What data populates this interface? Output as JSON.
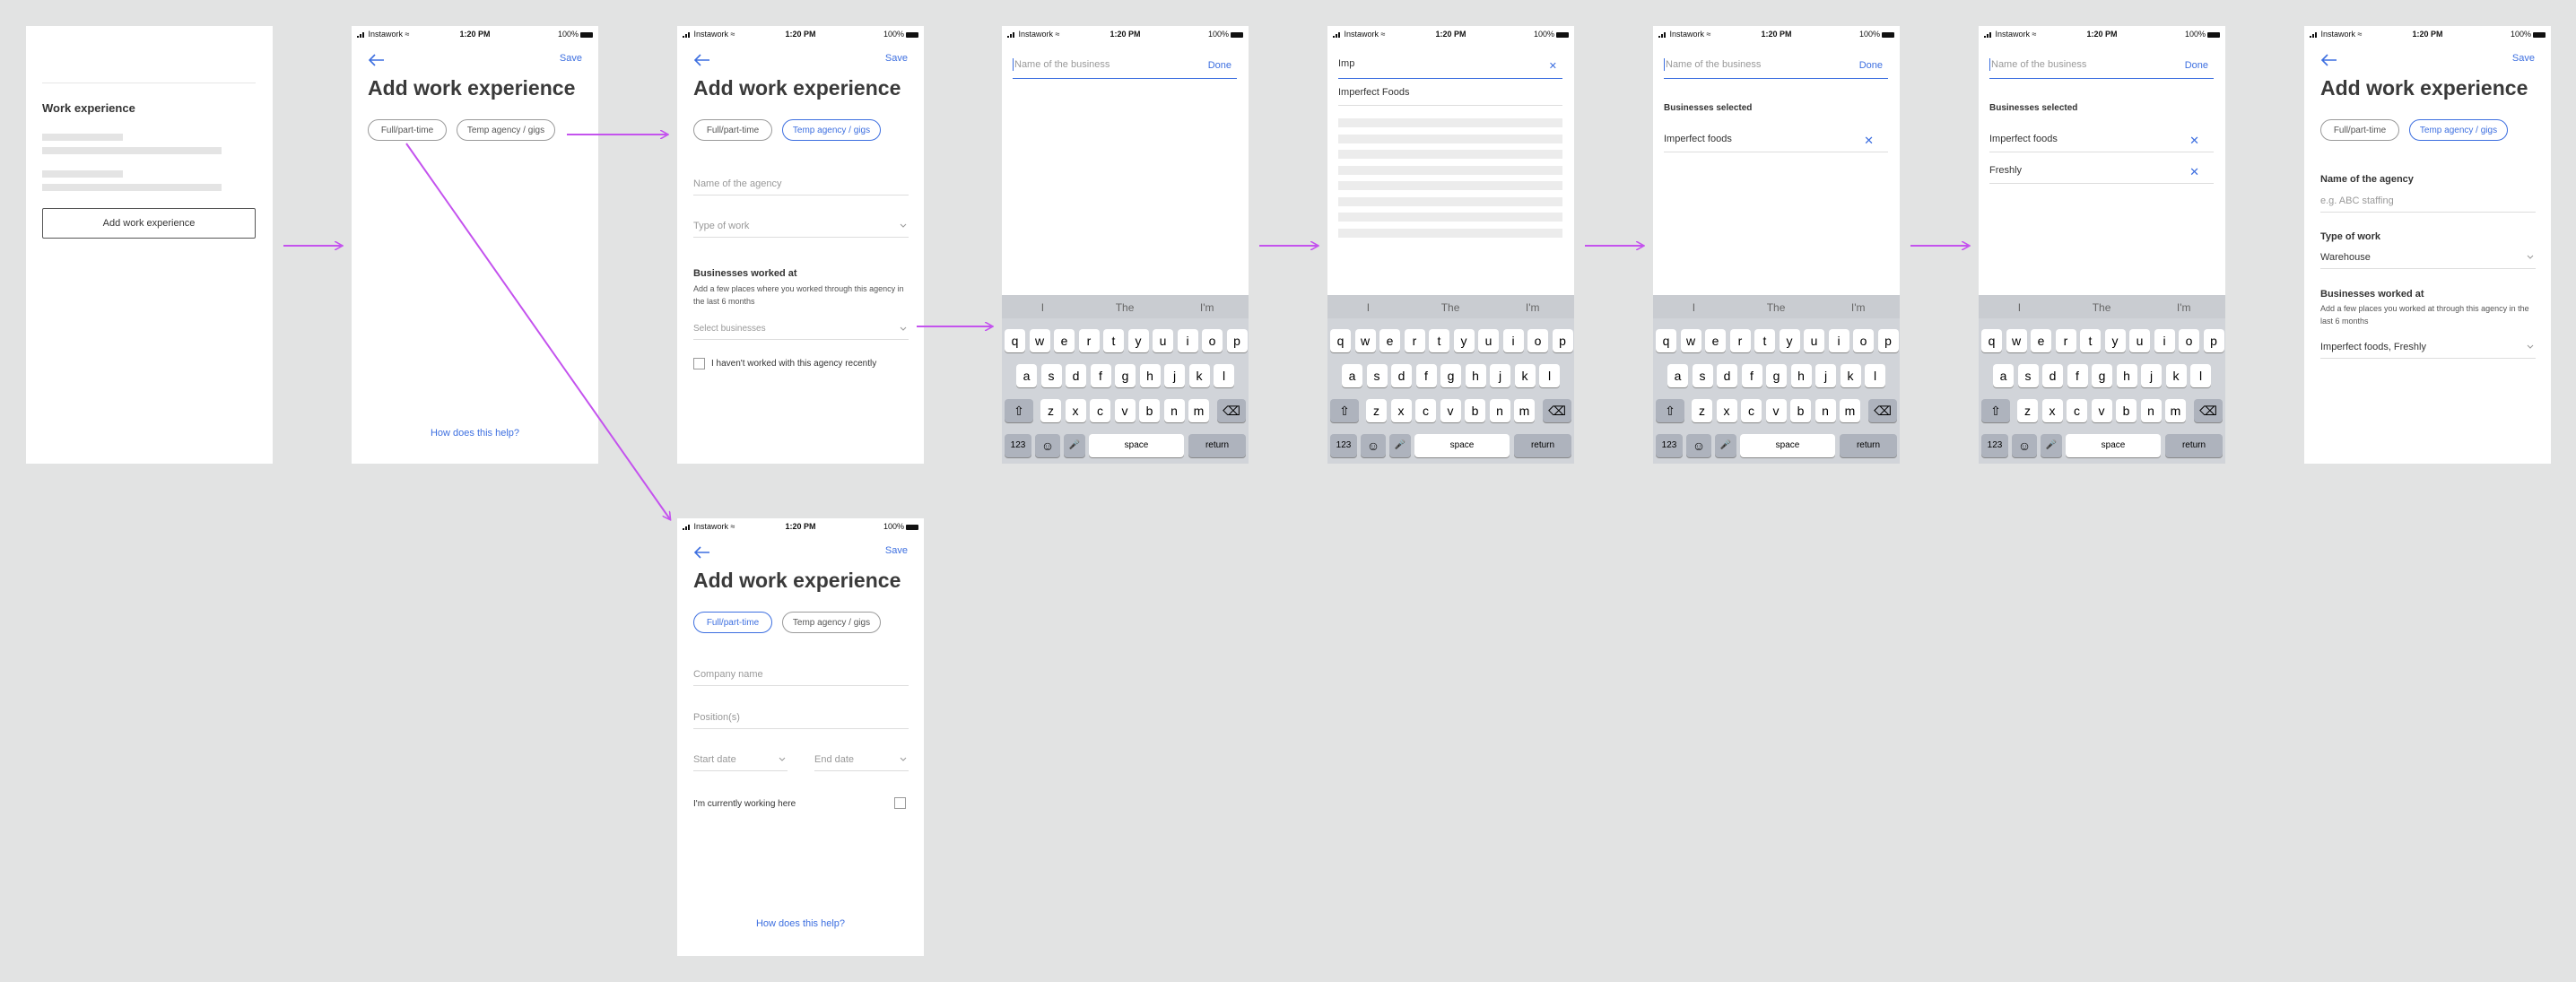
{
  "status": {
    "carrier": "Instawork",
    "time": "1:20 PM",
    "battery": "100%"
  },
  "common": {
    "title": "Add work experience",
    "save": "Save",
    "chip_full": "Full/part-time",
    "chip_temp": "Temp agency / gigs",
    "how_help": "How does this help?"
  },
  "screen1": {
    "heading": "Work experience",
    "button": "Add work experience"
  },
  "agency": {
    "name_placeholder": "Name of the agency",
    "type_placeholder": "Type of work",
    "biz_heading": "Businesses worked at",
    "biz_help": "Add a few places where you worked through this agency in the last 6 months",
    "select_placeholder": "Select businesses",
    "not_recent": "I haven't worked with this agency recently"
  },
  "fulltime": {
    "company_placeholder": "Company name",
    "position_placeholder": "Position(s)",
    "start_placeholder": "Start date",
    "end_placeholder": "End date",
    "current": "I'm currently working here"
  },
  "search": {
    "placeholder": "Name of the business",
    "done": "Done",
    "query": "Imp",
    "result": "Imperfect Foods",
    "selected_heading": "Businesses selected",
    "selected_1": "Imperfect foods",
    "selected_2": "Freshly"
  },
  "keyboard": {
    "suggestions": [
      "I",
      "The",
      "I'm"
    ],
    "row1": [
      "q",
      "w",
      "e",
      "r",
      "t",
      "y",
      "u",
      "i",
      "o",
      "p"
    ],
    "row2": [
      "a",
      "s",
      "d",
      "f",
      "g",
      "h",
      "j",
      "k",
      "l"
    ],
    "row3": [
      "z",
      "x",
      "c",
      "v",
      "b",
      "n",
      "m"
    ],
    "num": "123",
    "space": "space",
    "return": "return"
  },
  "final": {
    "agency_label": "Name of the agency",
    "agency_placeholder": "e.g. ABC staffing",
    "type_label": "Type of work",
    "type_value": "Warehouse",
    "biz_heading": "Businesses worked at",
    "biz_help": "Add a few places you worked at through this agency in the last 6 months",
    "biz_value": "Imperfect foods, Freshly"
  },
  "colors": {
    "accent": "#3d6fe0",
    "arrow": "#c453ee",
    "canvas": "#e2e3e3"
  }
}
